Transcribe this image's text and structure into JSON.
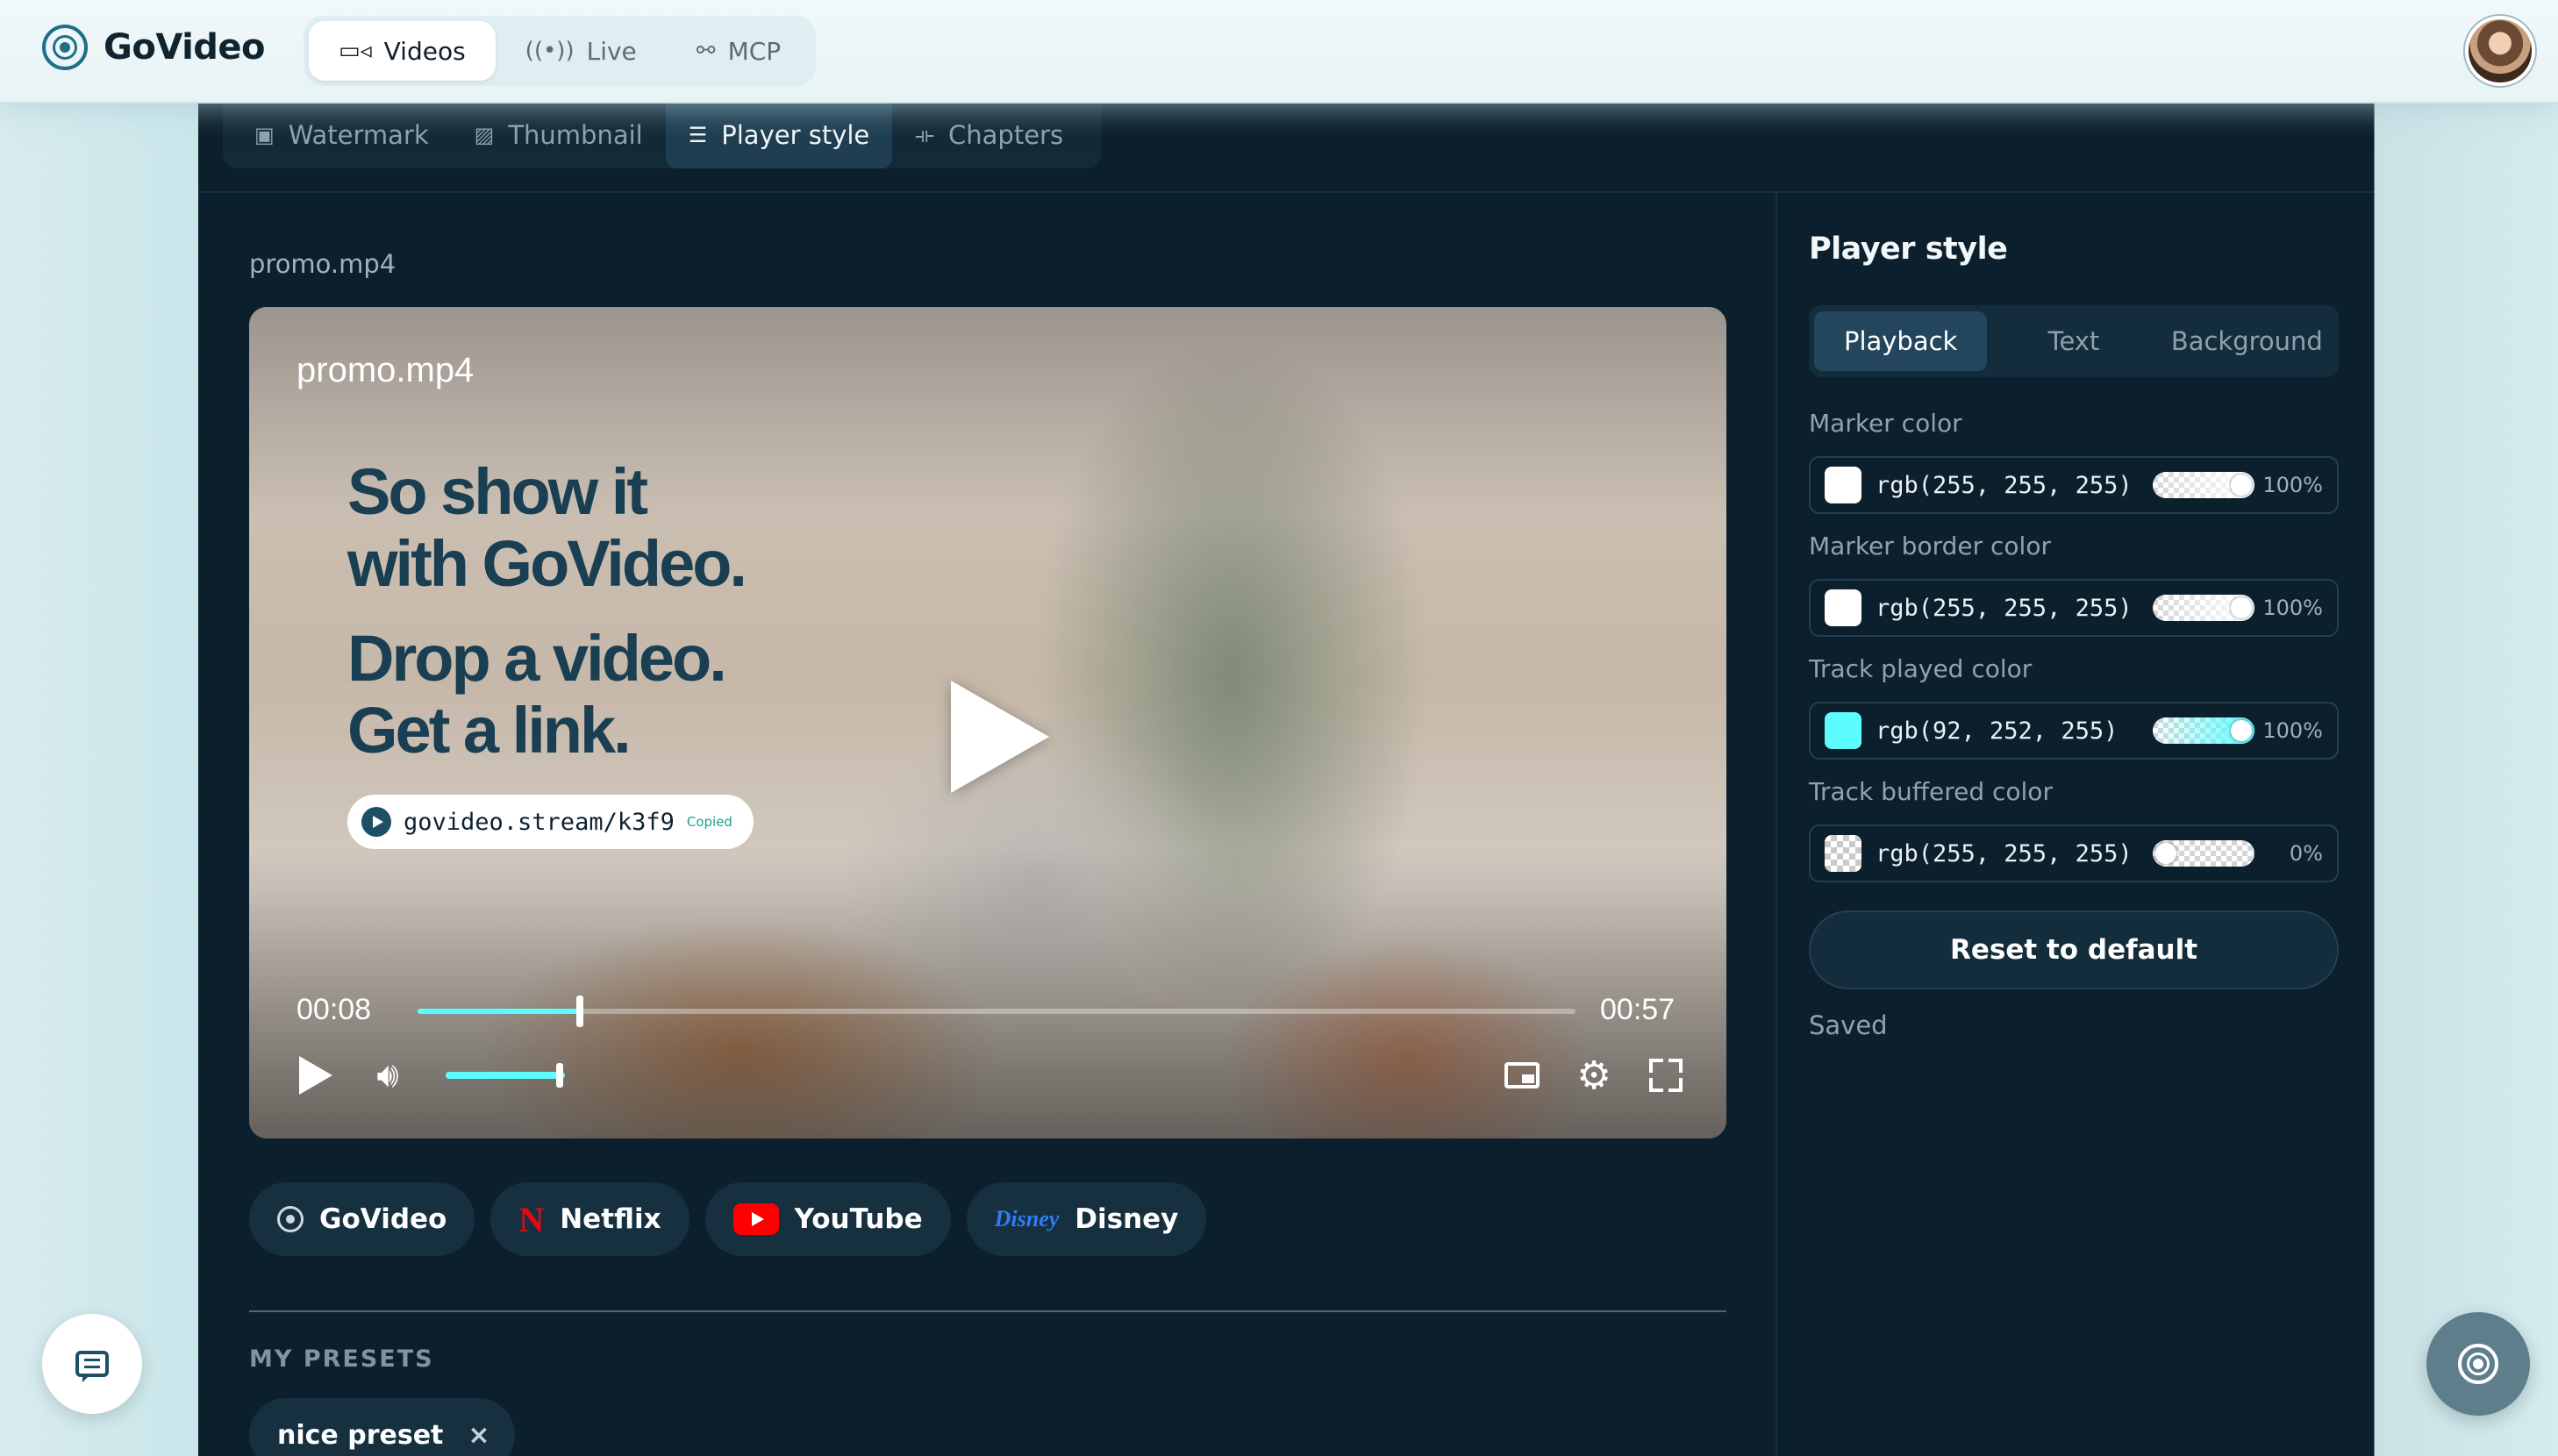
{
  "app": {
    "name": "GoVideo"
  },
  "nav": {
    "tabs": [
      {
        "label": "Videos",
        "icon": "video-camera-icon",
        "active": true
      },
      {
        "label": "Live",
        "icon": "broadcast-icon",
        "active": false
      },
      {
        "label": "MCP",
        "icon": "nodes-icon",
        "active": false
      }
    ]
  },
  "subtabs": [
    {
      "label": "Watermark",
      "icon": "watermark-icon",
      "active": false
    },
    {
      "label": "Thumbnail",
      "icon": "image-icon",
      "active": false
    },
    {
      "label": "Player style",
      "icon": "sliders-icon",
      "active": true
    },
    {
      "label": "Chapters",
      "icon": "chapters-icon",
      "active": false
    }
  ],
  "editor": {
    "filename": "promo.mp4"
  },
  "video": {
    "title": "promo.mp4",
    "headline": [
      "So show it",
      "with GoVideo.",
      "Drop a video.",
      "Get a link."
    ],
    "link_url": "govideo.stream/k3f9",
    "link_status": "Copied",
    "current_time": "00:08",
    "duration": "00:57",
    "progress": 0.14,
    "volume": 1.0,
    "accent_color": "#5cfcff"
  },
  "themes": [
    {
      "label": "GoVideo",
      "icon": "govideo-logo-icon"
    },
    {
      "label": "Netflix",
      "icon": "netflix-logo-icon"
    },
    {
      "label": "YouTube",
      "icon": "youtube-logo-icon"
    },
    {
      "label": "Disney",
      "icon": "disney-logo-icon",
      "icon_text": "Disney"
    }
  ],
  "presets": {
    "title": "MY PRESETS",
    "items": [
      {
        "label": "nice preset",
        "remove": "×"
      }
    ]
  },
  "player_style": {
    "title": "Player style",
    "segments": [
      {
        "label": "Playback",
        "active": true
      },
      {
        "label": "Text",
        "active": false
      },
      {
        "label": "Background",
        "active": false
      }
    ],
    "fields": [
      {
        "label": "Marker color",
        "value": "rgb(255, 255, 255)",
        "swatch": "#ffffff",
        "alpha": "100%",
        "alpha_fraction": 1.0
      },
      {
        "label": "Marker border color",
        "value": "rgb(255, 255, 255)",
        "swatch": "#ffffff",
        "alpha": "100%",
        "alpha_fraction": 1.0
      },
      {
        "label": "Track played color",
        "value": "rgb(92, 252, 255)",
        "swatch": "#5cfcff",
        "alpha": "100%",
        "alpha_fraction": 1.0
      },
      {
        "label": "Track buffered color",
        "value": "rgb(255, 255, 255)",
        "swatch": "transparent",
        "alpha": "0%",
        "alpha_fraction": 0.0
      }
    ],
    "reset_label": "Reset to default",
    "status": "Saved"
  },
  "floating": {
    "chat_icon": "chat-icon",
    "brand_icon": "govideo-logo-icon"
  }
}
